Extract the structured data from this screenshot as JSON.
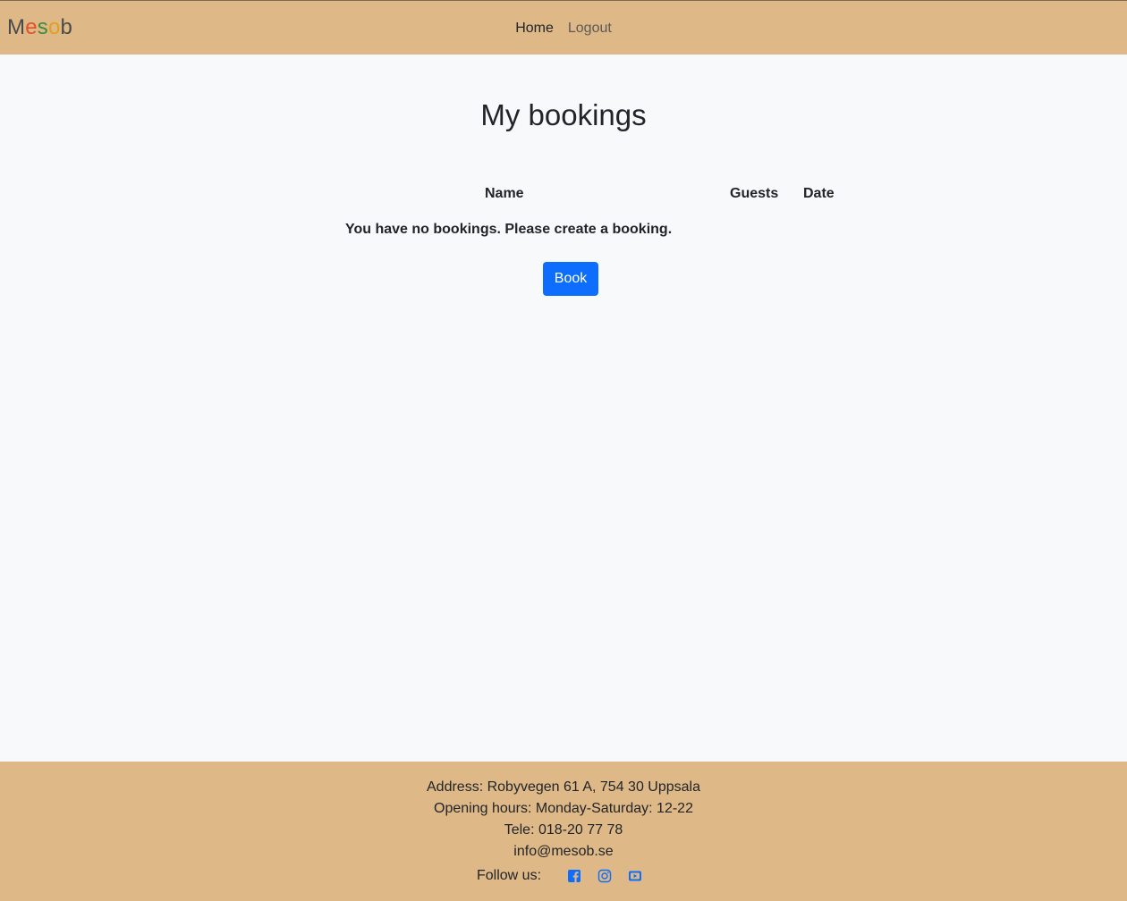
{
  "brand": {
    "letters": [
      {
        "char": "M",
        "color": "#4a4a4a"
      },
      {
        "char": "e",
        "color": "#e0522a"
      },
      {
        "char": "s",
        "color": "#3c8c3c"
      },
      {
        "char": "o",
        "color": "#e0a020"
      },
      {
        "char": "b",
        "color": "#4a4a4a"
      }
    ]
  },
  "nav": {
    "home_label": "Home",
    "logout_label": "Logout"
  },
  "main": {
    "title": "My bookings",
    "table": {
      "columns": [
        "Name",
        "Guests",
        "Date"
      ],
      "empty_message": "You have no bookings. Please create a booking."
    },
    "book_button_label": "Book"
  },
  "footer": {
    "address": "Address: Robyvegen 61 A, 754 30 Uppsala",
    "hours": "Opening hours: Monday-Saturday: 12-22",
    "tele": "Tele: 018-20 77 78",
    "email": "info@mesob.se",
    "follow_label": "Follow us:",
    "social_icons": [
      "facebook-icon",
      "instagram-icon",
      "youtube-icon"
    ],
    "social_color": "#0d6efd"
  },
  "colors": {
    "header_bg": "#deb887",
    "page_bg": "#f8f9fa",
    "primary": "#0d6efd"
  }
}
